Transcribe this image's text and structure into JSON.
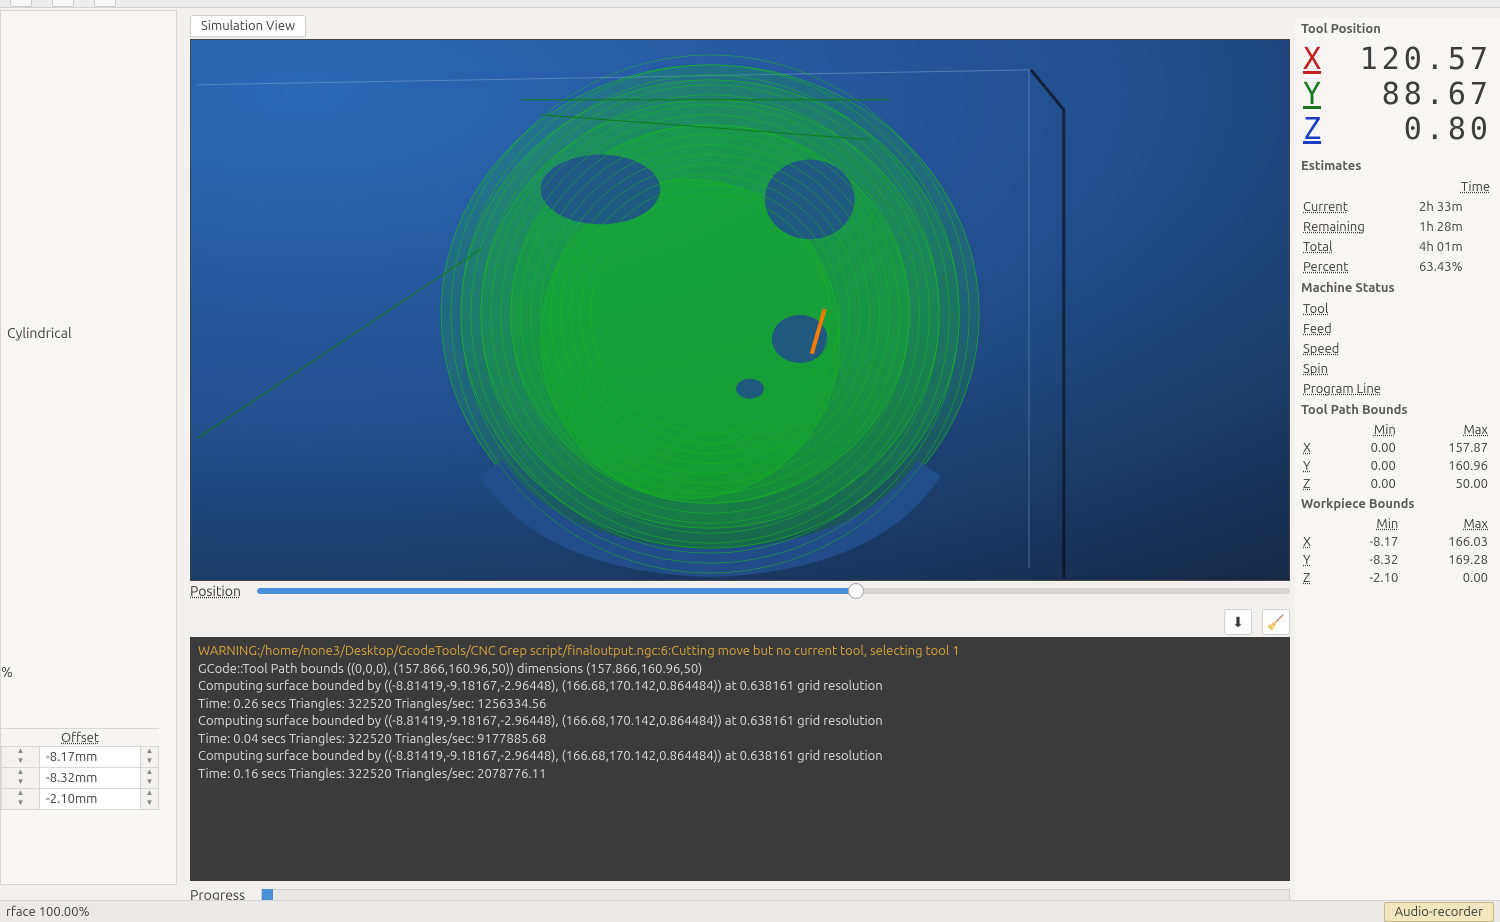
{
  "tab": {
    "label": "Simulation View"
  },
  "left": {
    "cylindrical_label": "Cylindrical",
    "percent_label": "%",
    "offset_header": "Offset",
    "offsets": [
      {
        "value": "-8.17mm"
      },
      {
        "value": "-8.32mm"
      },
      {
        "value": "-2.10mm"
      }
    ]
  },
  "position_slider": {
    "label": "Position"
  },
  "console": {
    "lines": [
      "WARNING:/home/none3/Desktop/GcodeTools/CNC Grep script/finaloutput.ngc:6:Cutting move but no current tool, selecting tool 1",
      "GCode::Tool Path bounds ((0,0,0), (157.866,160.96,50)) dimensions (157.866,160.96,50)",
      "Computing surface bounded by ((-8.81419,-9.18167,-2.96448), (166.68,170.142,0.864484)) at 0.638161 grid resolution",
      "Time: 0.26 secs Triangles: 322520 Triangles/sec: 1256334.56",
      "Computing surface bounded by ((-8.81419,-9.18167,-2.96448), (166.68,170.142,0.864484)) at 0.638161 grid resolution",
      "Time: 0.04 secs Triangles: 322520 Triangles/sec: 9177885.68",
      "Computing surface bounded by ((-8.81419,-9.18167,-2.96448), (166.68,170.142,0.864484)) at 0.638161 grid resolution",
      "Time: 0.16 secs Triangles: 322520 Triangles/sec: 2078776.11"
    ]
  },
  "progress": {
    "label": "Progress"
  },
  "right": {
    "tool_position": {
      "title": "Tool Position",
      "x_label": "X",
      "x_value": "120.57",
      "y_label": "Y",
      "y_value": "88.67",
      "z_label": "Z",
      "z_value": "0.80"
    },
    "estimates": {
      "title": "Estimates",
      "time_header": "Time",
      "rows": [
        {
          "label": "Current",
          "value": "2h 33m"
        },
        {
          "label": "Remaining",
          "value": "1h 28m"
        },
        {
          "label": "Total",
          "value": "4h 01m"
        },
        {
          "label": "Percent",
          "value": "63.43%"
        }
      ]
    },
    "machine_status": {
      "title": "Machine Status",
      "rows": [
        {
          "label": "Tool"
        },
        {
          "label": "Feed"
        },
        {
          "label": "Speed"
        },
        {
          "label": "Spin"
        },
        {
          "label": "Program Line"
        }
      ]
    },
    "tool_path_bounds": {
      "title": "Tool Path Bounds",
      "min_header": "Min",
      "max_header": "Max",
      "rows": [
        {
          "axis": "X",
          "min": "0.00",
          "max": "157.87"
        },
        {
          "axis": "Y",
          "min": "0.00",
          "max": "160.96"
        },
        {
          "axis": "Z",
          "min": "0.00",
          "max": "50.00"
        }
      ]
    },
    "workpiece_bounds": {
      "title": "Workpiece Bounds",
      "min_header": "Min",
      "max_header": "Max",
      "rows": [
        {
          "axis": "X",
          "min": "-8.17",
          "max": "166.03"
        },
        {
          "axis": "Y",
          "min": "-8.32",
          "max": "169.28"
        },
        {
          "axis": "Z",
          "min": "-2.10",
          "max": "0.00"
        }
      ]
    }
  },
  "status_bar": {
    "surface_text": "rface 100.00%",
    "audio_label": "Audio-recorder"
  }
}
